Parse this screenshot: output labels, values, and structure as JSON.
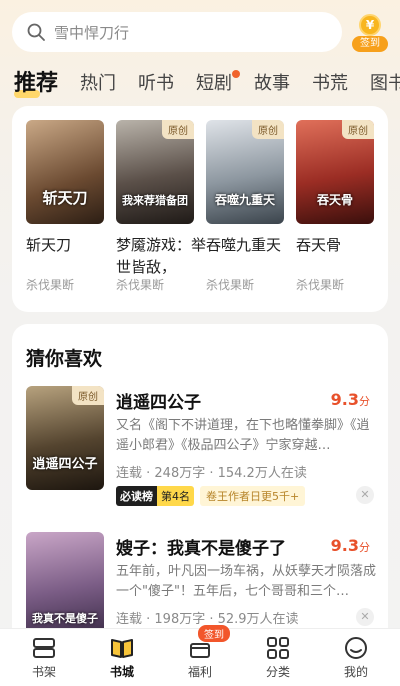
{
  "search": {
    "placeholder": "雪中悍刀行"
  },
  "checkin": {
    "coin": "¥",
    "label": "签到"
  },
  "tabs": [
    {
      "label": "推荐",
      "active": true
    },
    {
      "label": "热门"
    },
    {
      "label": "听书"
    },
    {
      "label": "短剧",
      "dot": true
    },
    {
      "label": "故事"
    },
    {
      "label": "书荒"
    },
    {
      "label": "图书"
    }
  ],
  "featured": [
    {
      "title": "斩天刀",
      "author": "杀伐果断",
      "cover_text": "斩天刀",
      "badge": ""
    },
    {
      "title": "梦魇游戏：举世皆敌，",
      "author": "杀伐果断",
      "cover_text": "我来荐猎备团",
      "badge": "原创"
    },
    {
      "title": "吞噬九重天",
      "author": "杀伐果断",
      "cover_text": "吞噬九重天",
      "badge": "原创"
    },
    {
      "title": "吞天骨",
      "author": "杀伐果断",
      "cover_text": "吞天骨",
      "badge": "原创"
    }
  ],
  "recommend": {
    "section_title": "猜你喜欢",
    "items": [
      {
        "title": "逍遥四公子",
        "score": "9.3",
        "score_unit": "分",
        "desc": "又名《阁下不讲道理，在下也略懂拳脚》《逍遥小郎君》《极品四公子》宁家穿越…",
        "meta": "连载 · 248万字 · 154.2万人在读",
        "badge": "原创",
        "cover_text": "逍遥四公子",
        "tag_dark": "必读榜",
        "tag_yellow": "第4名",
        "tag_light": "卷王作者日更5千+"
      },
      {
        "title": "嫂子：我真不是傻子了",
        "score": "9.3",
        "score_unit": "分",
        "desc": "五年前，叶凡因一场车祸，从妖孽天才陨落成一个\"傻子\"！五年后，七个哥哥和三个…",
        "meta": "连载 · 198万字 · 52.9万人在读",
        "cover_text": "我真不是傻子"
      }
    ]
  },
  "nav": [
    {
      "label": "书架",
      "icon": "bookshelf-icon"
    },
    {
      "label": "书城",
      "icon": "bookstore-icon",
      "active": true
    },
    {
      "label": "福利",
      "icon": "welfare-icon",
      "badge": "签到"
    },
    {
      "label": "分类",
      "icon": "category-icon"
    },
    {
      "label": "我的",
      "icon": "profile-icon"
    }
  ],
  "colors": {
    "accent": "#f8b61f",
    "score": "#e8512b",
    "badge_bg": "#f3e3c4"
  }
}
